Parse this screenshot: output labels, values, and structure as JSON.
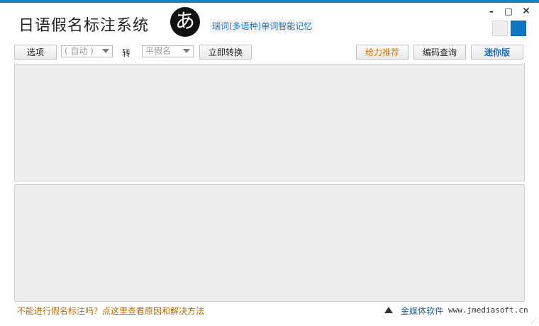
{
  "header": {
    "title": "日语假名标注系统",
    "logo_glyph": "あ",
    "promo_link": "瑞词(多语种)单词智能记忆"
  },
  "window_controls": {
    "minimize": "–",
    "maximize": "□",
    "close": "✕"
  },
  "skins": {
    "light_color": "#eeeeee",
    "blue_color": "#0d77c6"
  },
  "toolbar": {
    "options_label": "选项",
    "source_select_value": "( 自动 )",
    "to_label": "转",
    "target_select_value": "平假名",
    "convert_label": "立即转换",
    "recommend_label": "给力推荐",
    "code_lookup_label": "编码查询",
    "mini_label": "迷你版"
  },
  "editor": {
    "input_text": "",
    "output_text": ""
  },
  "footer": {
    "help_link": "不能进行假名标注吗？点这里查看原因和解决方法",
    "publisher_icon": "publisher-triangle-icon",
    "publisher_name": "金媒体软件",
    "publisher_url": "www.jmediasoft.cn"
  },
  "colors": {
    "accent": "#1e7fc9",
    "recommend_text": "#d47a00",
    "mini_text": "#1e6fb5",
    "help_text": "#b56c00"
  }
}
